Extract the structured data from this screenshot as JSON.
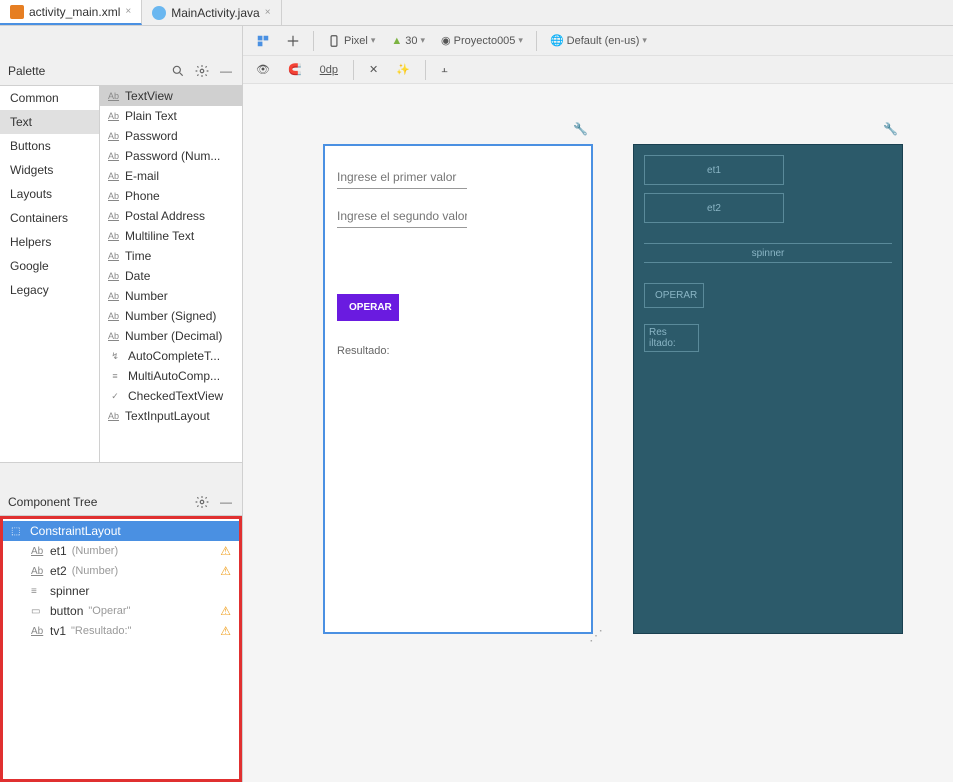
{
  "tabs": [
    {
      "label": "activity_main.xml",
      "active": true,
      "type": "xml"
    },
    {
      "label": "MainActivity.java",
      "active": false,
      "type": "java"
    }
  ],
  "palette": {
    "title": "Palette",
    "categories": [
      "Common",
      "Text",
      "Buttons",
      "Widgets",
      "Layouts",
      "Containers",
      "Helpers",
      "Google",
      "Legacy"
    ],
    "selectedCategory": "Text",
    "items": [
      "TextView",
      "Plain Text",
      "Password",
      "Password (Num...",
      "E-mail",
      "Phone",
      "Postal Address",
      "Multiline Text",
      "Time",
      "Date",
      "Number",
      "Number (Signed)",
      "Number (Decimal)",
      "AutoCompleteT...",
      "MultiAutoComp...",
      "CheckedTextView",
      "TextInputLayout"
    ],
    "selectedItem": "TextView"
  },
  "componentTree": {
    "title": "Component Tree",
    "root": "ConstraintLayout",
    "children": [
      {
        "name": "et1",
        "type": "(Number)",
        "warn": true,
        "icon": "ab"
      },
      {
        "name": "et2",
        "type": "(Number)",
        "warn": true,
        "icon": "ab"
      },
      {
        "name": "spinner",
        "type": "",
        "warn": false,
        "icon": "spinner"
      },
      {
        "name": "button",
        "text": "\"Operar\"",
        "warn": true,
        "icon": "button"
      },
      {
        "name": "tv1",
        "text": "\"Resultado:\"",
        "warn": true,
        "icon": "ab"
      }
    ]
  },
  "toolbar": {
    "device": "Pixel",
    "api": "30",
    "project": "Proyecto005",
    "locale": "Default (en-us)",
    "margin": "0dp"
  },
  "preview": {
    "hint1": "Ingrese el primer valor",
    "hint2": "Ingrese el segundo valor",
    "button": "OPERAR",
    "result": "Resultado:"
  },
  "blueprint": {
    "et1": "et1",
    "et2": "et2",
    "spinner": "spinner",
    "button": "OPERAR",
    "result": "Res iltado:"
  }
}
